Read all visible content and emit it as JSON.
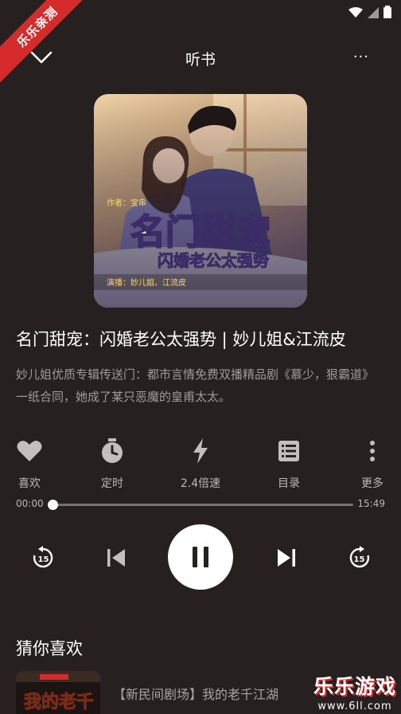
{
  "status_bar": {
    "icons": [
      "wifi-icon",
      "signal-icon",
      "battery-icon"
    ]
  },
  "ribbon": {
    "text": "乐乐亲测"
  },
  "header": {
    "title": "听书",
    "more_label": "..."
  },
  "cover": {
    "author_tag": "作者：宝串",
    "main_title": "名门甜宠",
    "subtitle": "闪婚老公太强势",
    "narrators": "演播：妙儿姐、江流皮"
  },
  "track": {
    "title": "名门甜宠：闪婚老公太强势 | 妙儿姐&江流皮",
    "description": "妙儿姐优质专辑传送门：都市言情免费双播精品剧《慕少，狠霸道》一纸合同，她成了某只恶魔的皇甫太太。"
  },
  "actions": [
    {
      "icon": "heart-icon",
      "label": "喜欢"
    },
    {
      "icon": "timer-icon",
      "label": "定时"
    },
    {
      "icon": "bolt-icon",
      "label": "2.4倍速"
    },
    {
      "icon": "list-icon",
      "label": "目录"
    },
    {
      "icon": "more-vertical-icon",
      "label": "更多"
    }
  ],
  "progress": {
    "current": "00:00",
    "total": "15:49",
    "fraction": 0.0
  },
  "controls": {
    "rewind_seconds": "15",
    "forward_seconds": "15",
    "state": "playing"
  },
  "recommend": {
    "section_title": "猜你喜欢",
    "items": [
      {
        "title": "【新民间剧场】我的老千江湖",
        "cover_text": "我的老千"
      }
    ]
  },
  "watermark": {
    "big": "乐乐游戏",
    "small": "www.6ll.com"
  },
  "colors": {
    "background": "#262120",
    "accent": "#d62b2b",
    "muted_text": "#a09a98"
  }
}
